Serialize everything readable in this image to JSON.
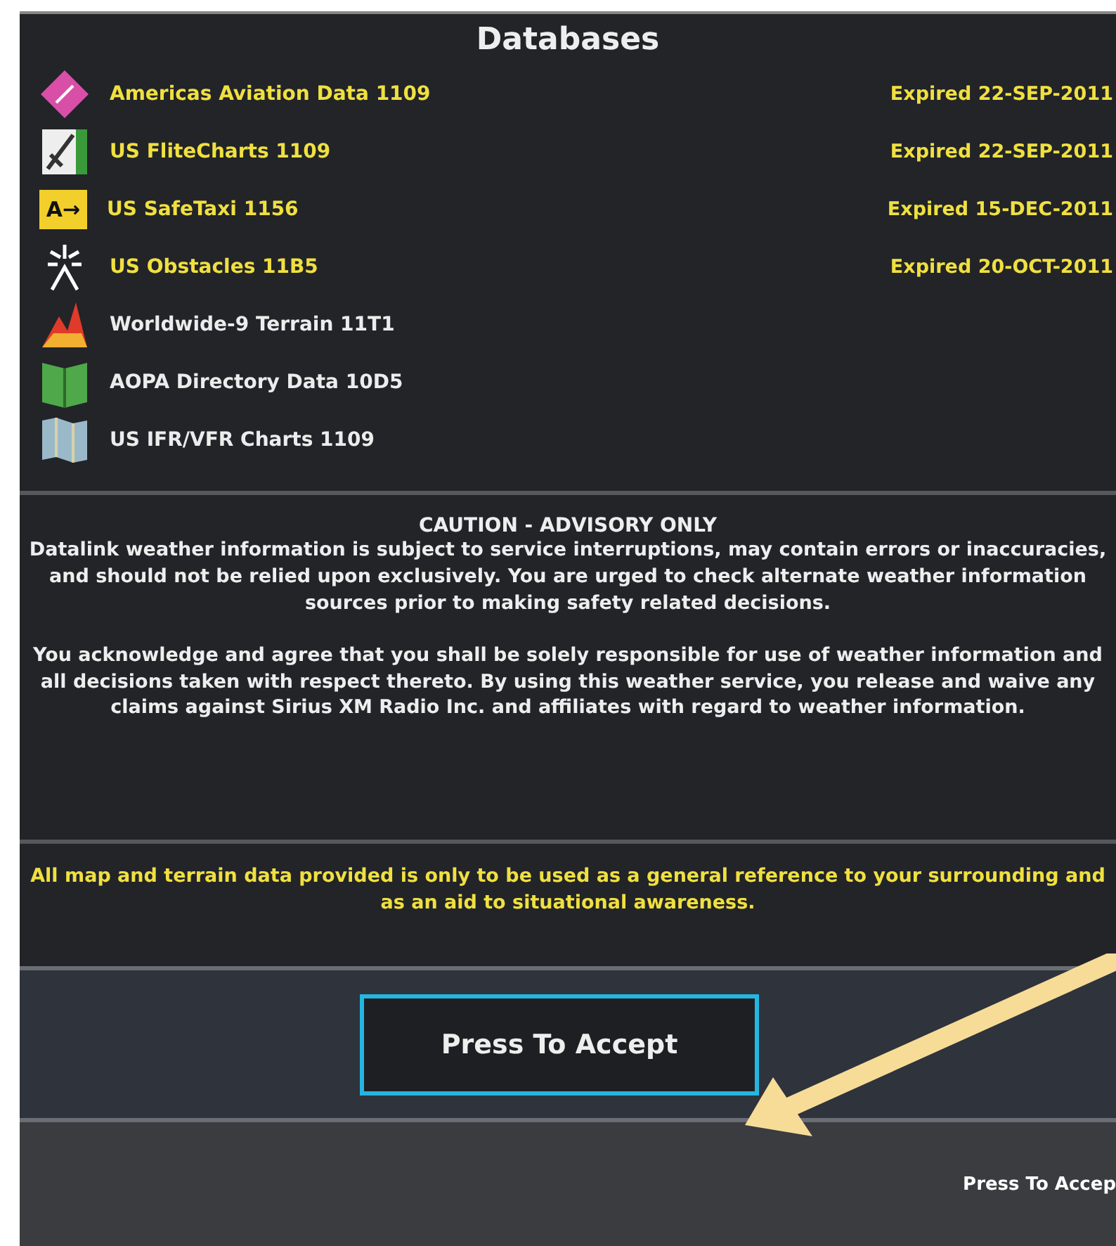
{
  "title": "Databases",
  "databases": [
    {
      "kind": "aviation",
      "name": "Americas Aviation Data 1109",
      "expired": true,
      "status": "Expired 22-SEP-2011"
    },
    {
      "kind": "flitecharts",
      "name": "US FliteCharts 1109",
      "expired": true,
      "status": "Expired 22-SEP-2011"
    },
    {
      "kind": "safetaxi",
      "icon_text": "A→",
      "name": "US SafeTaxi 1156",
      "expired": true,
      "status": "Expired 15-DEC-2011"
    },
    {
      "kind": "obstacles",
      "name": "US Obstacles 11B5",
      "expired": true,
      "status": "Expired 20-OCT-2011"
    },
    {
      "kind": "terrain",
      "name": "Worldwide-9 Terrain 11T1",
      "expired": false
    },
    {
      "kind": "directory",
      "name": "AOPA Directory Data 10D5",
      "expired": false
    },
    {
      "kind": "charts",
      "name": "US IFR/VFR Charts 1109",
      "expired": false
    }
  ],
  "caution": {
    "heading": "CAUTION - ADVISORY ONLY",
    "paragraphs": [
      "Datalink weather information is subject to service interruptions, may contain errors or inaccuracies, and should not be relied upon exclusively. You are urged to check alternate weather information sources prior to making safety related decisions.",
      "You acknowledge and agree that you shall be solely responsible for use of weather information and all decisions taken with respect thereto. By using this weather service, you release and waive any claims against Sirius XM Radio Inc. and affiliates with regard to weather information."
    ]
  },
  "notice": "All map and terrain data provided is only to be used as a general reference to your surrounding and as an aid to situational awareness.",
  "accept_button": "Press To Accept",
  "status_bar": "Press To Accep"
}
